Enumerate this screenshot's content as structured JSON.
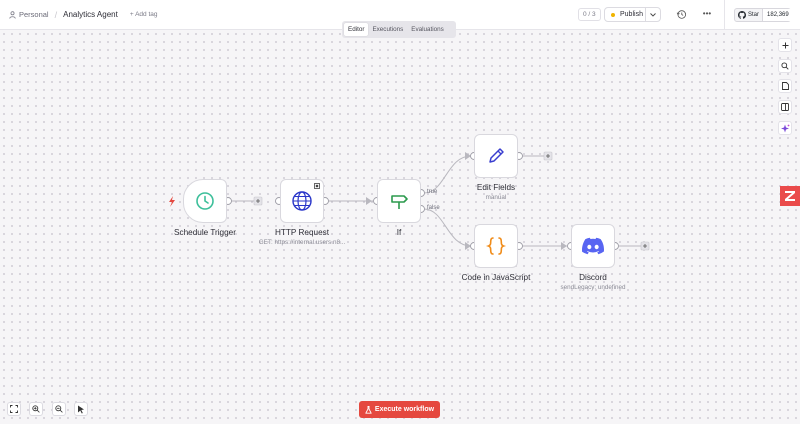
{
  "header": {
    "project": "Personal",
    "workflow_name": "Analytics Agent",
    "add_tag": "+ Add tag",
    "counter": "0 / 3",
    "publish_label": "Publish",
    "github_star": "Star",
    "github_count": "182,369"
  },
  "tabs": [
    {
      "label": "Editor",
      "active": true
    },
    {
      "label": "Executions",
      "active": false
    },
    {
      "label": "Evaluations",
      "active": false
    }
  ],
  "nodes": {
    "schedule": {
      "label": "Schedule Trigger",
      "icon": "clock-icon"
    },
    "http": {
      "label": "HTTP Request",
      "subtitle": "GET: https://internal.users.n8...",
      "icon": "globe-icon"
    },
    "if": {
      "label": "If",
      "icon": "signpost-icon",
      "true_label": "true",
      "false_label": "false"
    },
    "edit": {
      "label": "Edit Fields",
      "subtitle": "manual",
      "icon": "pencil-icon"
    },
    "code": {
      "label": "Code in JavaScript",
      "icon": "braces-icon"
    },
    "discord": {
      "label": "Discord",
      "subtitle": "sendLegacy: undefined",
      "icon": "discord-icon"
    }
  },
  "footer": {
    "execute_label": "Execute workflow"
  },
  "colors": {
    "accent": "#e5483f",
    "clock": "#3cbf9a",
    "globe": "#2a36c9",
    "signpost": "#2c9a4d",
    "pencil": "#3a3ecf",
    "braces": "#f08c1a",
    "discord": "#5865f2"
  }
}
